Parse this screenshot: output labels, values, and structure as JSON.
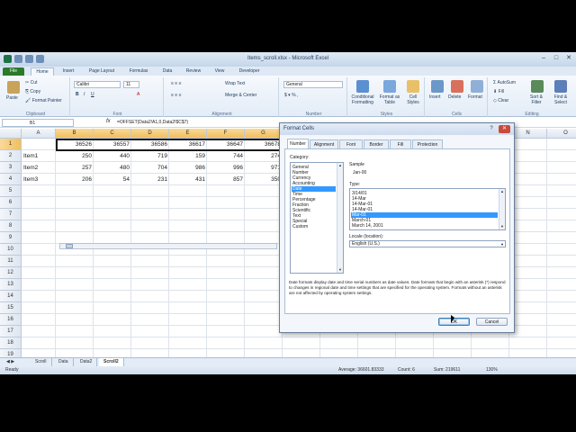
{
  "window": {
    "title": "Items_scroll.xlsx - Microsoft Excel",
    "min": "–",
    "max": "□",
    "close": "✕"
  },
  "ribbon_tabs": [
    "File",
    "Home",
    "Insert",
    "Page Layout",
    "Formulas",
    "Data",
    "Review",
    "View",
    "Developer"
  ],
  "ribbon": {
    "paste": "Paste",
    "cut": "Cut",
    "copy": "Copy",
    "format_painter": "Format Painter",
    "clipboard": "Clipboard",
    "font_name": "Calibri",
    "font_size": "11",
    "font_group": "Font",
    "wrap_text": "Wrap Text",
    "merge_center": "Merge & Center",
    "alignment": "Alignment",
    "number_format": "General",
    "number": "Number",
    "conditional_formatting": "Conditional Formatting",
    "format_as_table": "Format as Table",
    "cell_styles": "Cell Styles",
    "styles": "Styles",
    "insert": "Insert",
    "delete": "Delete",
    "format": "Format",
    "cells": "Cells",
    "autosum": "AutoSum",
    "fill": "Fill",
    "clear": "Clear",
    "sort_filter": "Sort & Filter",
    "find_select": "Find & Select",
    "editing": "Editing"
  },
  "formula_bar": {
    "name_box": "B1",
    "fx": "fx",
    "formula": "=OFFSET(Data2!A1,0,Data2!$C$7)"
  },
  "columns": [
    "A",
    "B",
    "C",
    "D",
    "E",
    "F",
    "G",
    "H",
    "I",
    "J",
    "K",
    "L",
    "M",
    "N",
    "O"
  ],
  "rows": [
    "1",
    "2",
    "3",
    "4",
    "5",
    "6",
    "7",
    "8",
    "9",
    "10",
    "11",
    "12",
    "13",
    "14",
    "15",
    "16",
    "17",
    "18",
    "19"
  ],
  "cells": {
    "r1": [
      "",
      "36526",
      "36557",
      "36586",
      "36617",
      "36647",
      "36678"
    ],
    "r2": [
      "Item1",
      "250",
      "440",
      "719",
      "159",
      "744",
      "274"
    ],
    "r3": [
      "Item2",
      "257",
      "480",
      "704",
      "986",
      "996",
      "971"
    ],
    "r4": [
      "Item3",
      "206",
      "54",
      "231",
      "431",
      "857",
      "350"
    ]
  },
  "sheet_tabs": [
    "Scroll",
    "Data",
    "Data2",
    "Scroll2"
  ],
  "status": {
    "ready": "Ready",
    "average": "Average: 36601.83333",
    "count": "Count: 6",
    "sum": "Sum: 219611",
    "zoom": "130%"
  },
  "dialog": {
    "title": "Format Cells",
    "help": "?",
    "close": "✕",
    "tabs": [
      "Number",
      "Alignment",
      "Font",
      "Border",
      "Fill",
      "Protection"
    ],
    "category_label": "Category:",
    "categories": [
      "General",
      "Number",
      "Currency",
      "Accounting",
      "Date",
      "Time",
      "Percentage",
      "Fraction",
      "Scientific",
      "Text",
      "Special",
      "Custom"
    ],
    "selected_category": 4,
    "sample_label": "Sample",
    "sample_value": "Jan-00",
    "type_label": "Type:",
    "types": [
      "3/14/01",
      "14-Mar",
      "14-Mar-01",
      "14-Mar-01",
      "Mar-01",
      "March-01",
      "March 14, 2001"
    ],
    "selected_type": 4,
    "locale_label": "Locale (location):",
    "locale_value": "English (U.S.)",
    "description": "Date formats display date and time serial numbers as date values. Date formats that begin with an asterisk (*) respond to changes in regional date and time settings that are specified for the operating system. Formats without an asterisk are not affected by operating system settings.",
    "ok": "OK",
    "cancel": "Cancel"
  }
}
